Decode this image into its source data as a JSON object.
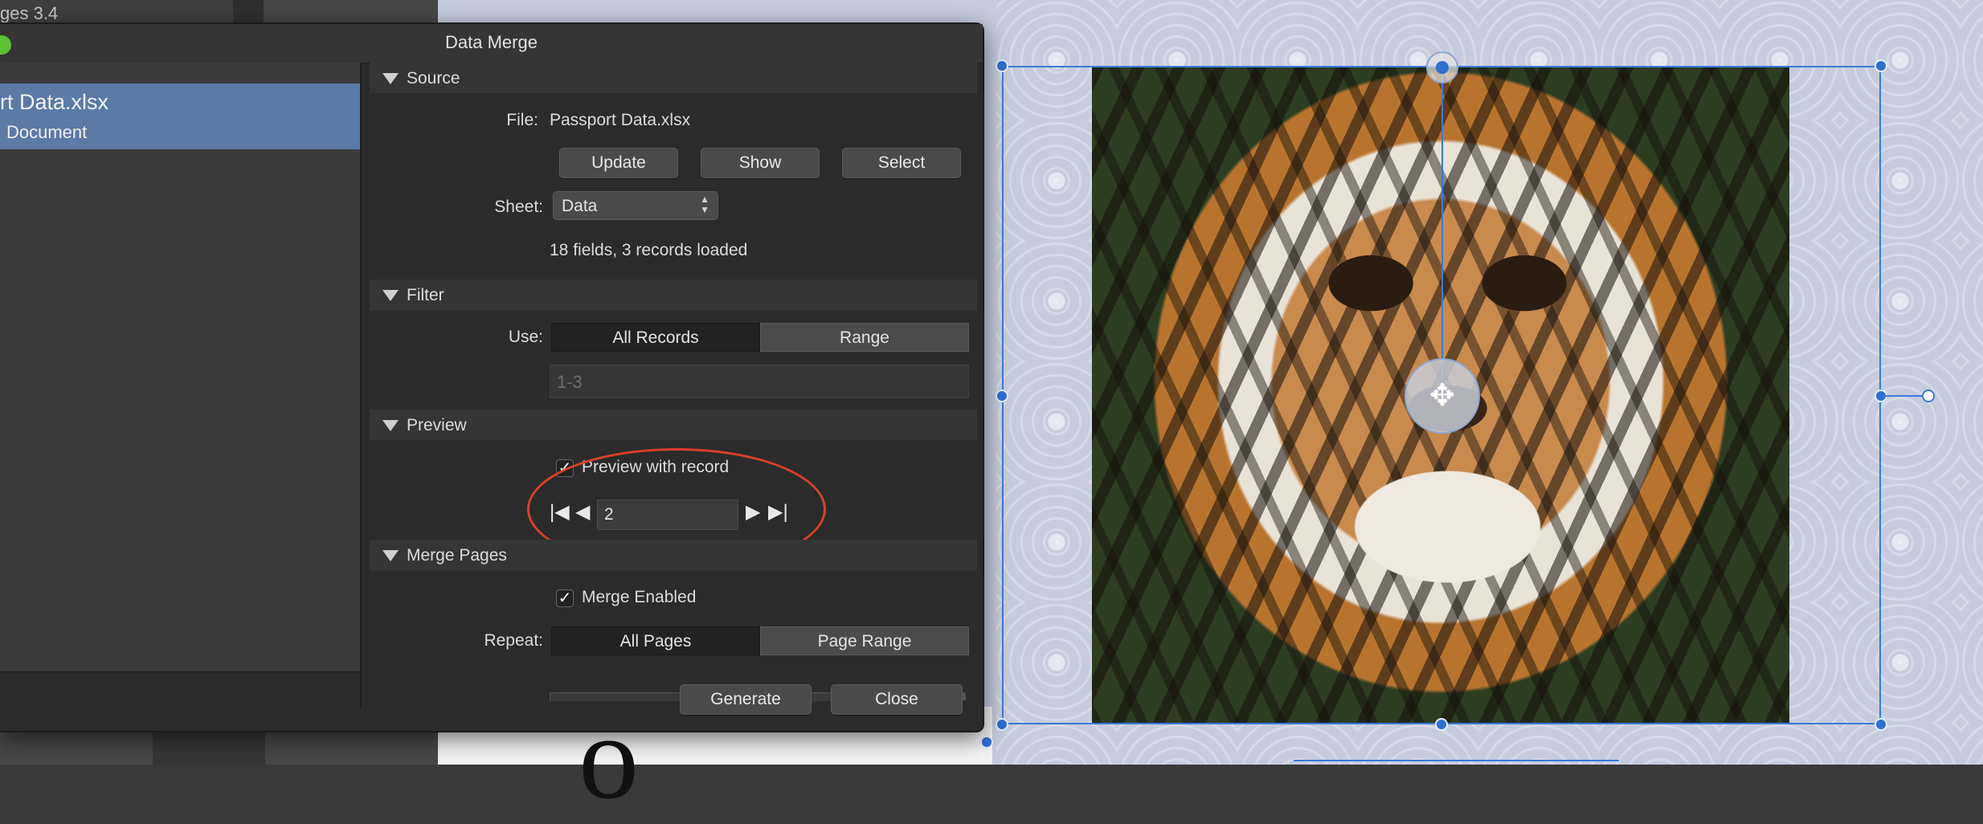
{
  "background": {
    "pages_label": "ges 3.4"
  },
  "dialog": {
    "title": "Data Merge",
    "file_list": {
      "selected_name": "rt Data.xlsx",
      "selected_type": "Document"
    },
    "source": {
      "header": "Source",
      "file_label": "File:",
      "file_value": "Passport Data.xlsx",
      "update_button": "Update",
      "show_button": "Show",
      "select_button": "Select",
      "sheet_label": "Sheet:",
      "sheet_value": "Data",
      "status": "18 fields, 3 records loaded"
    },
    "filter": {
      "header": "Filter",
      "use_label": "Use:",
      "option_all": "All Records",
      "option_range": "Range",
      "selected": "All Records",
      "range_placeholder": "1-3"
    },
    "preview": {
      "header": "Preview",
      "checkbox_label": "Preview with record",
      "checked": true,
      "record_value": "2"
    },
    "merge_pages": {
      "header": "Merge Pages",
      "checkbox_label": "Merge Enabled",
      "checked": true,
      "repeat_label": "Repeat:",
      "option_all": "All Pages",
      "option_range": "Page Range",
      "selected": "All Pages"
    },
    "generate_button": "Generate",
    "close_button": "Close"
  },
  "icons": {
    "checkmark": "✓",
    "first": "|◀",
    "prev": "◀",
    "next": "▶",
    "last": "▶|",
    "move": "✥",
    "chevron": "▲\n▼"
  },
  "colors": {
    "selection": "#3b7ad8",
    "annotation": "#d8402a",
    "file_item_highlight": "#5b7aa6",
    "traffic_light_green": "#5bc236"
  }
}
